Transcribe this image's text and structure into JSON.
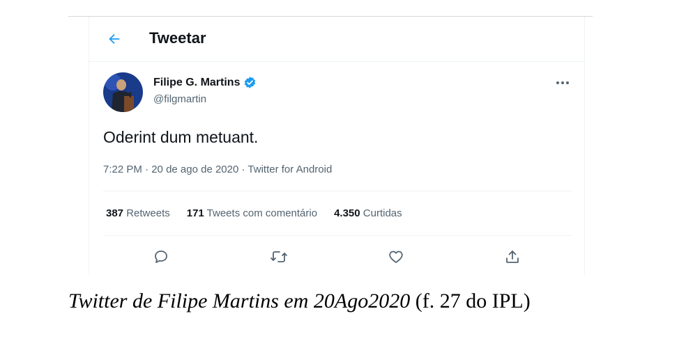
{
  "header": {
    "title": "Tweetar"
  },
  "tweet": {
    "author_name": "Filipe G. Martins",
    "author_handle": "@filgmartin",
    "text": "Oderint dum metuant.",
    "time": "7:22 PM",
    "date": "20 de ago de 2020",
    "client": "Twitter for Android",
    "separator": " · ",
    "stats": {
      "retweets_count": "387",
      "retweets_label": "Retweets",
      "comments_count": "171",
      "comments_label": "Tweets com comentário",
      "likes_count": "4.350",
      "likes_label": "Curtidas"
    }
  },
  "caption": {
    "italic": "Twitter de Filipe Martins em 20Ago2020",
    "plain": " (f. 27 do IPL)"
  },
  "colors": {
    "accent": "#1d9bf0",
    "text": "#0f1419",
    "muted": "#536471",
    "border": "#eff3f4"
  },
  "icons": [
    "back-arrow-icon",
    "verified-badge-icon",
    "more-icon",
    "reply-icon",
    "retweet-icon",
    "like-icon",
    "share-icon"
  ]
}
